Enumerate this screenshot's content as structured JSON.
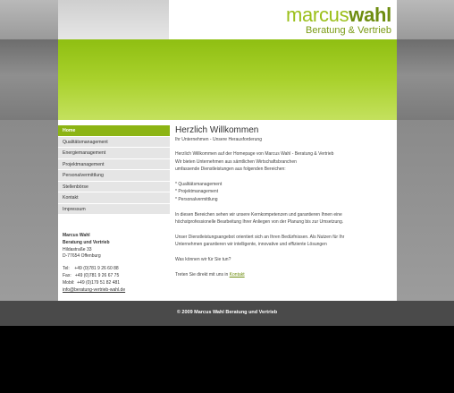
{
  "logo": {
    "part1": "marcus",
    "part2": "wahl",
    "tagline": "Beratung & Vertrieb"
  },
  "nav": {
    "items": [
      {
        "label": "Home",
        "active": true
      },
      {
        "label": "Qualitätsmanagement"
      },
      {
        "label": "Energiemanagement"
      },
      {
        "label": "Projektmanagement"
      },
      {
        "label": "Personalvermittlung"
      },
      {
        "label": "Stellenbörse"
      },
      {
        "label": "Kontakt"
      },
      {
        "label": "Impressum"
      }
    ]
  },
  "contact": {
    "name": "Marcus Wahl",
    "company": "Beratung und Vertrieb",
    "street": "Hildastraße 33",
    "city": "D-77654 Offenburg",
    "tel": "Tel:    +49 (0)781 9 26 60 88",
    "fax": "Fax:   +49 (0)781 9 26 67 75",
    "mobil": "Mobil:  +49 (0)179 51 82 481",
    "email": "info@beratung-vertrieb-wahl.de"
  },
  "main": {
    "title": "Herzlich Willkommen",
    "subtitle": "Ihr Unternehmen - Unsere Herausforderung",
    "intro1": "Herzlich Willkommen auf der Homepage von Marcus Wahl - Beratung & Vertrieb",
    "intro2": "Wir bieten Unternehmen aus sämtlichen Wirtschaftsbranchen",
    "intro3": "umfassende Dienstleistungen aus folgenden Bereichen:",
    "list1": "* Qualitätsmanagement",
    "list2": "* Projektmanagement",
    "list3": "* Personalvermittlung",
    "para1a": "In diesen Bereichen sehen wir unsere Kernkompetenzen und garantieren Ihnen eine",
    "para1b": "höchstprofessionelle Bearbeitung Ihrer Anliegen von der Planung bis zur Umsetzung.",
    "para2a": "Unser Dienstleistungsangebot orientiert sich an Ihren Bedürfnissen. Als Nutzen für Ihr",
    "para2b": "Unternehmen garantieren wir intelligente, innovative und effiziente Lösungen",
    "question": "Was können wir für Sie tun?",
    "cta_prefix": "Treten Sie direkt mit uns in ",
    "cta_link": "Kontakt"
  },
  "footer": {
    "text": "© 2009 Marcus Wahl Beratung und Vertrieb"
  }
}
